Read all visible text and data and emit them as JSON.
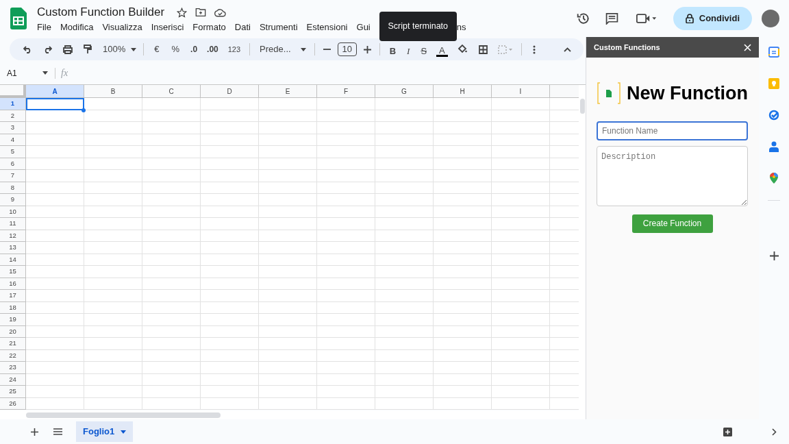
{
  "document": {
    "title": "Custom Function Builder"
  },
  "menu": [
    "File",
    "Modifica",
    "Visualizza",
    "Inserisci",
    "Formato",
    "Dati",
    "Strumenti",
    "Estensioni",
    "Gui"
  ],
  "tooltip": "Script terminato",
  "menu_after_tooltip": [
    "ns"
  ],
  "share_button": "Condividi",
  "toolbar": {
    "zoom": "100%",
    "currency": "€",
    "percent": "%",
    "decimal_decrease": ".0",
    "decimal_increase": ".00",
    "number_format": "123",
    "font": "Prede...",
    "font_size": "10",
    "bold": "B",
    "italic": "I",
    "strike": "S",
    "text_color": "A"
  },
  "name_box": "A1",
  "formula_label": "fx",
  "grid": {
    "columns": [
      {
        "label": "A",
        "selected": true
      },
      {
        "label": "B",
        "selected": false
      },
      {
        "label": "C",
        "selected": false
      },
      {
        "label": "D",
        "selected": false
      },
      {
        "label": "E",
        "selected": false
      },
      {
        "label": "F",
        "selected": false
      },
      {
        "label": "G",
        "selected": false
      },
      {
        "label": "H",
        "selected": false
      },
      {
        "label": "I",
        "selected": false
      }
    ],
    "rows": [
      {
        "label": "1",
        "selected": true
      },
      {
        "label": "2",
        "selected": false
      },
      {
        "label": "3",
        "selected": false
      },
      {
        "label": "4",
        "selected": false
      },
      {
        "label": "5",
        "selected": false
      },
      {
        "label": "6",
        "selected": false
      },
      {
        "label": "7",
        "selected": false
      },
      {
        "label": "8",
        "selected": false
      },
      {
        "label": "9",
        "selected": false
      },
      {
        "label": "10",
        "selected": false
      },
      {
        "label": "11",
        "selected": false
      },
      {
        "label": "12",
        "selected": false
      },
      {
        "label": "13",
        "selected": false
      },
      {
        "label": "14",
        "selected": false
      },
      {
        "label": "15",
        "selected": false
      },
      {
        "label": "16",
        "selected": false
      },
      {
        "label": "17",
        "selected": false
      },
      {
        "label": "18",
        "selected": false
      },
      {
        "label": "19",
        "selected": false
      },
      {
        "label": "20",
        "selected": false
      },
      {
        "label": "21",
        "selected": false
      },
      {
        "label": "22",
        "selected": false
      },
      {
        "label": "23",
        "selected": false
      },
      {
        "label": "24",
        "selected": false
      },
      {
        "label": "25",
        "selected": false
      },
      {
        "label": "26",
        "selected": false
      }
    ]
  },
  "panel": {
    "title": "Custom Functions",
    "heading": "New Function",
    "name_field": {
      "placeholder": "Function Name"
    },
    "description_field": {
      "placeholder": "Description"
    },
    "button": "Create Function"
  },
  "sheets": [
    {
      "label": "Foglio1",
      "selected": true
    }
  ]
}
